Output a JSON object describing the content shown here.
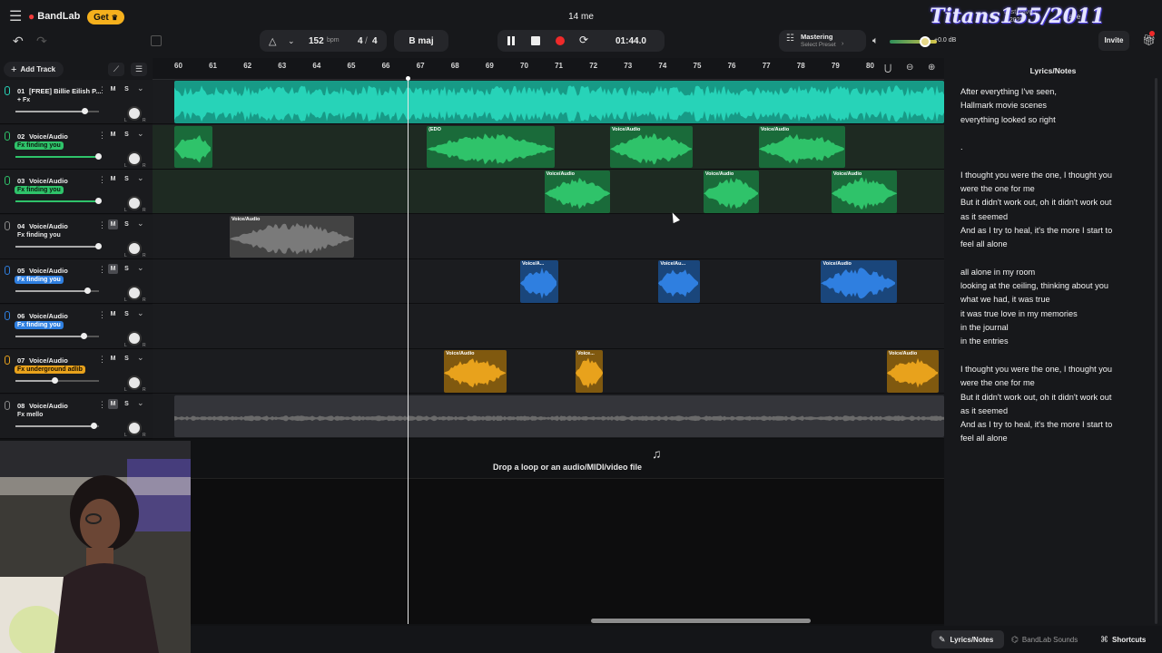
{
  "app": {
    "name": "BandLab",
    "get_label": "Get",
    "project_title": "14 me"
  },
  "header": {
    "last_saved_label": "Last Saved",
    "last_saved_value": "...2025",
    "save_label": "Save",
    "watermark": "Titans155/2011",
    "bpm_value": "152",
    "bpm_unit": "bpm",
    "time_sig_top": "4",
    "time_sig_bottom": "4",
    "key": "B maj",
    "time": "01:44.0",
    "mastering_label": "Mastering",
    "mastering_sub": "Select Preset",
    "volume_db": "+0.0 dB",
    "invite_label": "Invite"
  },
  "toolbar": {
    "add_track_label": "Add Track"
  },
  "ruler": {
    "bars": [
      "60",
      "61",
      "62",
      "63",
      "64",
      "65",
      "66",
      "67",
      "68",
      "69",
      "70",
      "71",
      "72",
      "73",
      "74",
      "75",
      "76",
      "77",
      "78",
      "79",
      "80"
    ]
  },
  "tracks": [
    {
      "number": "01",
      "name": "[FREE] Billie Eilish P...",
      "fx": "+ Fx",
      "color": "#27d3b8",
      "fx_style": "plain",
      "volume": 0.83
    },
    {
      "number": "02",
      "name": "Voice/Audio",
      "fx": "Fx finding you",
      "color": "#2fc36a",
      "fx_style": "green",
      "volume": 0.99
    },
    {
      "number": "03",
      "name": "Voice/Audio",
      "fx": "Fx finding you",
      "color": "#2fc36a",
      "fx_style": "green",
      "volume": 0.99
    },
    {
      "number": "04",
      "name": "Voice/Audio",
      "fx": "Fx finding you",
      "color": "#8a8a8a",
      "fx_style": "plain",
      "volume": 0.99
    },
    {
      "number": "05",
      "name": "Voice/Audio",
      "fx": "Fx finding you",
      "color": "#2f7fe0",
      "fx_style": "blue",
      "volume": 0.86
    },
    {
      "number": "06",
      "name": "Voice/Audio",
      "fx": "Fx finding you",
      "color": "#2f7fe0",
      "fx_style": "blue",
      "volume": 0.82
    },
    {
      "number": "07",
      "name": "Voice/Audio",
      "fx": "Fx underground adlib",
      "color": "#e8a21c",
      "fx_style": "orange",
      "volume": 0.47
    },
    {
      "number": "08",
      "name": "Voice/Audio",
      "fx": "Fx mello",
      "color": "#8a8a8a",
      "fx_style": "plain",
      "volume": 0.93
    }
  ],
  "clips": [
    {
      "lane": 0,
      "start_bar": 60.0,
      "end_bar": 83.0,
      "label": "",
      "color": "#27d3b8"
    },
    {
      "lane": 1,
      "start_bar": 60.0,
      "end_bar": 61.1,
      "label": "",
      "color": "#2fc36a"
    },
    {
      "lane": 1,
      "start_bar": 67.3,
      "end_bar": 71.0,
      "label": "(EDO",
      "color": "#2fc36a"
    },
    {
      "lane": 1,
      "start_bar": 72.6,
      "end_bar": 75.0,
      "label": "Voice/Audio",
      "color": "#2fc36a"
    },
    {
      "lane": 1,
      "start_bar": 76.9,
      "end_bar": 79.4,
      "label": "Voice/Audio",
      "color": "#2fc36a"
    },
    {
      "lane": 2,
      "start_bar": 70.7,
      "end_bar": 72.6,
      "label": "Voice/Audio",
      "color": "#2fc36a"
    },
    {
      "lane": 2,
      "start_bar": 75.3,
      "end_bar": 76.9,
      "label": "Voice/Audio",
      "color": "#2fc36a"
    },
    {
      "lane": 2,
      "start_bar": 79.0,
      "end_bar": 80.9,
      "label": "Voice/Audio",
      "color": "#2fc36a"
    },
    {
      "lane": 3,
      "start_bar": 61.6,
      "end_bar": 65.2,
      "label": "Voice/Audio",
      "color": "#7a7a7a"
    },
    {
      "lane": 4,
      "start_bar": 70.0,
      "end_bar": 71.1,
      "label": "Voice/A...",
      "color": "#2f7fe0"
    },
    {
      "lane": 4,
      "start_bar": 74.0,
      "end_bar": 75.2,
      "label": "Voice/Au...",
      "color": "#2f7fe0"
    },
    {
      "lane": 4,
      "start_bar": 78.7,
      "end_bar": 80.9,
      "label": "Voice/Audio",
      "color": "#2f7fe0"
    },
    {
      "lane": 6,
      "start_bar": 67.8,
      "end_bar": 69.6,
      "label": "Voice/Audio",
      "color": "#e8a21c"
    },
    {
      "lane": 6,
      "start_bar": 71.6,
      "end_bar": 72.4,
      "label": "Voice...",
      "color": "#e8a21c"
    },
    {
      "lane": 6,
      "start_bar": 80.6,
      "end_bar": 82.1,
      "label": "Voice/Audio",
      "color": "#e8a21c"
    },
    {
      "lane": 7,
      "start_bar": 60.0,
      "end_bar": 83.0,
      "label": "",
      "color": "#6a6a6a"
    }
  ],
  "dropzone": {
    "text": "Drop a loop or an audio/MIDI/video file"
  },
  "lyrics_panel": {
    "title": "Lyrics/Notes",
    "lines": [
      "After everything I've seen,",
      "Hallmark movie scenes",
      "everything looked so right",
      "",
      ".",
      "",
      "I thought you were the one, I thought you",
      "were the one for me",
      "But it didn't work out, oh it didn't work out",
      "as it seemed",
      "And as I try to heal, it's the more I start to",
      "feel all alone",
      "",
      "all alone in my room",
      "looking at the ceiling, thinking about you",
      "what we had, it was true",
      "it was true love in my memories",
      "in the journal",
      "in the entries",
      "",
      "I thought you were the one, I thought you",
      "were the one for me",
      "But it didn't work out, oh it didn't work out",
      "as it seemed",
      "And as I try to heal, it's the more I start to",
      "feel all alone"
    ]
  },
  "bottom_tabs": [
    {
      "label": "Lyrics/Notes",
      "active": true
    },
    {
      "label": "BandLab Sounds",
      "active": false
    },
    {
      "label": "Shortcuts",
      "active": false
    }
  ]
}
